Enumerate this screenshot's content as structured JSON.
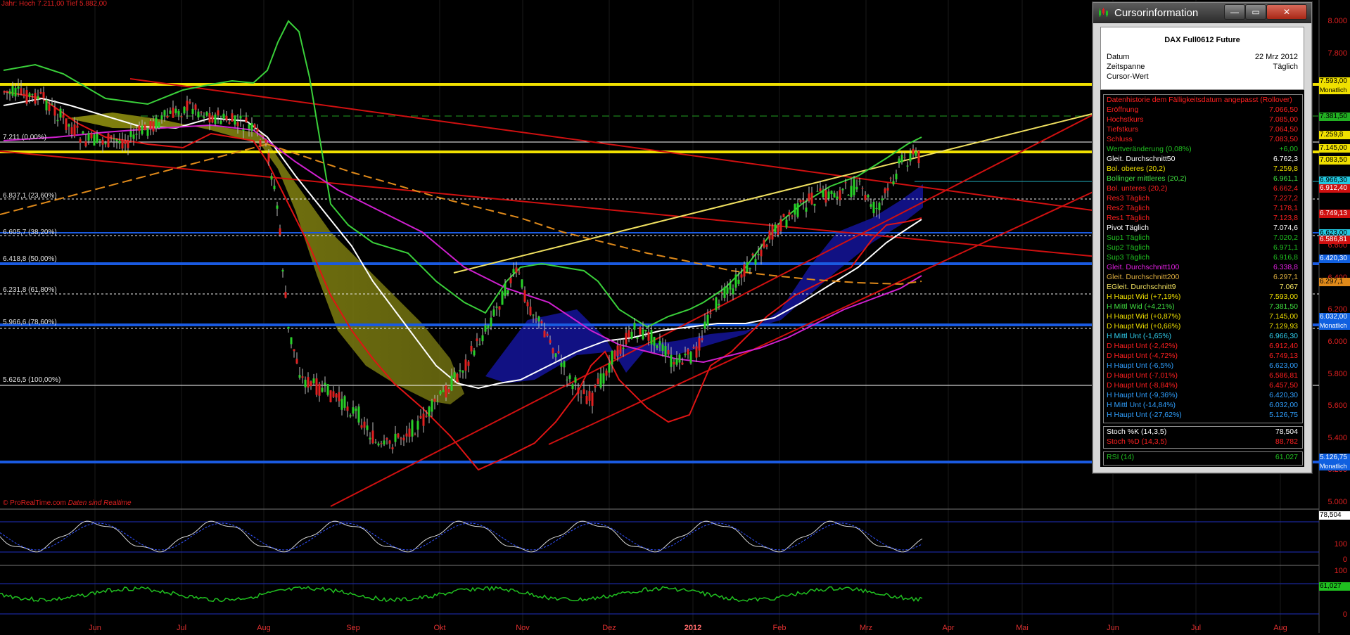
{
  "header": {
    "text": "Jahr: Hoch 7.211,00 Tief 5.882,00"
  },
  "credit": {
    "brand": "© ProRealTime.com",
    "note": "Daten sind Realtime"
  },
  "fib_labels": [
    "7.211 (0,00%)",
    "6.837,1 (23,60%)",
    "6.605,7 (38,20%)",
    "6.418,8 (50,00%)",
    "6.231,8 (61,80%)",
    "5.966,6 (78,60%)",
    "5.626,5 (100,00%)"
  ],
  "x_labels": [
    "Jun",
    "Jul",
    "Aug",
    "Sep",
    "Okt",
    "Nov",
    "Dez",
    "2012",
    "Feb",
    "Mrz",
    "Apr",
    "Mai",
    "Jun",
    "Jul",
    "Aug"
  ],
  "y_labels": [
    "8.000",
    "7.800",
    "7.600",
    "7.400",
    "7.200",
    "7.000",
    "6.800",
    "6.600",
    "6.400",
    "6.200",
    "6.000",
    "5.800",
    "5.600",
    "5.400",
    "5.200",
    "5.000"
  ],
  "badges": [
    {
      "text": "7.593,00",
      "sub": "Monatlich",
      "color": "#f0e000",
      "fg": "#000"
    },
    {
      "text": "7.381,50",
      "color": "#22b022",
      "fg": "#000"
    },
    {
      "text": "7.259,8",
      "color": "#f0e000",
      "fg": "#000"
    },
    {
      "text": "7.145,00",
      "color": "#f0e000",
      "fg": "#000"
    },
    {
      "text": "7.083,50",
      "color": "#f0e000",
      "fg": "#000"
    },
    {
      "text": "6.966,30",
      "color": "#22c8e0",
      "fg": "#000"
    },
    {
      "text": "6.912,40",
      "color": "#d01010",
      "fg": "#fff"
    },
    {
      "text": "6.749,13",
      "color": "#d01010",
      "fg": "#fff"
    },
    {
      "text": "6.623,00",
      "color": "#22c8e0",
      "fg": "#000"
    },
    {
      "text": "6.586,81",
      "color": "#d01010",
      "fg": "#fff"
    },
    {
      "text": "6.420,30",
      "color": "#1060e0",
      "fg": "#fff"
    },
    {
      "text": "6.297,1",
      "color": "#e08a1a",
      "fg": "#000"
    },
    {
      "text": "6.032,00",
      "sub": "Monatlich",
      "color": "#1060e0",
      "fg": "#fff"
    },
    {
      "text": "5.126,75",
      "sub": "Monatlich",
      "color": "#1060e0",
      "fg": "#fff"
    }
  ],
  "stoch": {
    "k_badge": "78,504",
    "levels": [
      "100",
      "0"
    ]
  },
  "rsi": {
    "badge": "61,027",
    "levels": [
      "100",
      "0"
    ]
  },
  "panel": {
    "title": "Cursorinformation",
    "buttons": {
      "minimize": "—",
      "maximize": "▭",
      "close": "✕"
    },
    "product": "DAX Full0612 Future",
    "info": [
      {
        "label": "Datum",
        "value": "22 Mrz 2012"
      },
      {
        "label": "Zeitspanne",
        "value": "Täglich"
      },
      {
        "label": "Cursor-Wert",
        "value": ""
      }
    ],
    "rows": [
      {
        "label": "Datenhistorie dem Fälligkeitsdatum angepasst (Rollover)",
        "value": "",
        "color": "#ff2020"
      },
      {
        "label": "Eröffnung",
        "value": "7.066,50",
        "color": "#ff2020"
      },
      {
        "label": "Hochstkurs",
        "value": "7.085,00",
        "color": "#ff2020"
      },
      {
        "label": "Tiefstkurs",
        "value": "7.064,50",
        "color": "#ff2020"
      },
      {
        "label": "Schluss",
        "value": "7.083,50",
        "color": "#ff2020"
      },
      {
        "label": "Wertveränderung (0,08%)",
        "value": "+6,00",
        "color": "#20c020"
      },
      {
        "label": "Gleit. Durchschnitt50",
        "value": "6.762,3",
        "color": "#ffffff"
      },
      {
        "label": "Bol. oberes (20,2)",
        "value": "7.259,8",
        "color": "#f0e000"
      },
      {
        "label": "Bollinger mittleres (20,2)",
        "value": "6.961,1",
        "color": "#40e040"
      },
      {
        "label": "Bol. unteres (20,2)",
        "value": "6.662,4",
        "color": "#ff2020"
      },
      {
        "label": "Res3 Täglich",
        "value": "7.227,2",
        "color": "#ff2020"
      },
      {
        "label": "Res2 Täglich",
        "value": "7.178,1",
        "color": "#ff2020"
      },
      {
        "label": "Res1 Täglich",
        "value": "7.123,8",
        "color": "#ff2020"
      },
      {
        "label": "Pivot Täglich",
        "value": "7.074,6",
        "color": "#ffffff"
      },
      {
        "label": "Sup1 Täglich",
        "value": "7.020,2",
        "color": "#20c020"
      },
      {
        "label": "Sup2 Täglich",
        "value": "6.971,1",
        "color": "#20c020"
      },
      {
        "label": "Sup3 Täglich",
        "value": "6.916,8",
        "color": "#20c020"
      },
      {
        "label": "Gleit. Durchschnitt100",
        "value": "6.338,8",
        "color": "#e020e0"
      },
      {
        "label": "Gleit. Durchschnitt200",
        "value": "6.297,1",
        "color": "#e0b040"
      },
      {
        "label": "EGleit. Durchschnitt9",
        "value": "7.067",
        "color": "#f0e060"
      },
      {
        "label": "H Haupt Wid (+7,19%)",
        "value": "7.593,00",
        "color": "#f0e000"
      },
      {
        "label": "H Mittl Wid (+4,21%)",
        "value": "7.381,50",
        "color": "#40e040"
      },
      {
        "label": "H Haupt Wid (+0,87%)",
        "value": "7.145,00",
        "color": "#f0e000"
      },
      {
        "label": "D Haupt Wid (+0,66%)",
        "value": "7.129,93",
        "color": "#f0e000"
      },
      {
        "label": "H Mittl Unt (-1,65%)",
        "value": "6.966,30",
        "color": "#30d0f0"
      },
      {
        "label": "D Haupt Unt (-2,42%)",
        "value": "6.912,40",
        "color": "#ff2020"
      },
      {
        "label": "D Haupt Unt (-4,72%)",
        "value": "6.749,13",
        "color": "#ff2020"
      },
      {
        "label": "H Haupt Unt (-6,5%)",
        "value": "6.623,00",
        "color": "#30a0ff"
      },
      {
        "label": "D Haupt Unt (-7,01%)",
        "value": "6.586,81",
        "color": "#ff2020"
      },
      {
        "label": "D Haupt Unt (-8,84%)",
        "value": "6.457,50",
        "color": "#ff2020"
      },
      {
        "label": "H Haupt Unt (-9,36%)",
        "value": "6.420,30",
        "color": "#30a0ff"
      },
      {
        "label": "H Mittl Unt (-14,84%)",
        "value": "6.032,00",
        "color": "#30a0ff"
      },
      {
        "label": "H Haupt Unt (-27,62%)",
        "value": "5.126,75",
        "color": "#30a0ff"
      }
    ],
    "stoch_rows": [
      {
        "label": "Stoch %K (14,3,5)",
        "value": "78,504",
        "color": "#ffffff"
      },
      {
        "label": "Stoch %D (14,3,5)",
        "value": "88,782",
        "color": "#ff2020"
      }
    ],
    "rsi_rows": [
      {
        "label": "RSI (14)",
        "value": "61,027",
        "color": "#20c020"
      }
    ]
  }
}
